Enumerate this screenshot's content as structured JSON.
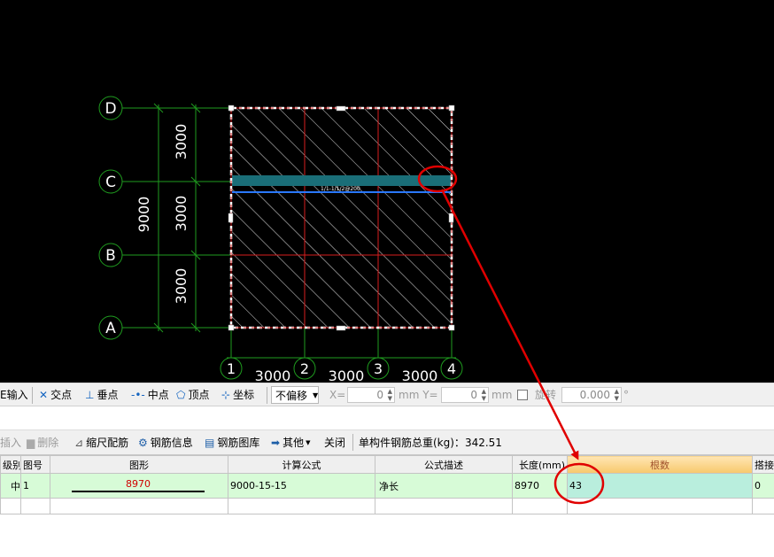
{
  "drawing": {
    "axis_rows": [
      "D",
      "C",
      "B",
      "A"
    ],
    "axis_cols": [
      "1",
      "2",
      "3",
      "4"
    ],
    "left_dims": [
      "3000",
      "3000",
      "3000"
    ],
    "left_total": "9000",
    "bottom_dims": [
      "3000",
      "3000",
      "3000"
    ],
    "rebar_note": "1/1-1/1/2@200"
  },
  "snapbar": {
    "input_label": "E输入",
    "snap_intersection": "交点",
    "snap_perpendicular": "垂点",
    "snap_midpoint": "中点",
    "snap_vertex": "顶点",
    "snap_coordinate": "坐标",
    "offset_mode": "不偏移",
    "x_label": "X=",
    "x_value": "0",
    "y_label": "mm Y=",
    "y_value": "0",
    "y_unit": "mm",
    "rotate_label": "旋转",
    "rotate_value": "0.000",
    "degree": "°"
  },
  "rebar_toolbar": {
    "insert": "插入",
    "delete": "删除",
    "scale_rebar": "缩尺配筋",
    "rebar_info": "钢筋信息",
    "rebar_library": "钢筋图库",
    "other": "其他",
    "close": "关闭",
    "total_weight_label": "单构件钢筋总重(kg)：",
    "total_weight": "342.51"
  },
  "table": {
    "headers": [
      "级别",
      "图号",
      "图形",
      "计算公式",
      "公式描述",
      "长度(mm)",
      "根数",
      "搭接"
    ],
    "row": {
      "grade": "中",
      "figure_no": "1",
      "shape_length": "8970",
      "formula": "9000-15-15",
      "formula_desc": "净长",
      "length": "8970",
      "count": "43",
      "lap": "0"
    }
  },
  "colors": {
    "canvas_bg": "#000000",
    "axis_green": "#1f9b1f",
    "grid_red": "#d81e1e",
    "annotation_red": "#e00000",
    "row_green": "#d7fbd7"
  }
}
